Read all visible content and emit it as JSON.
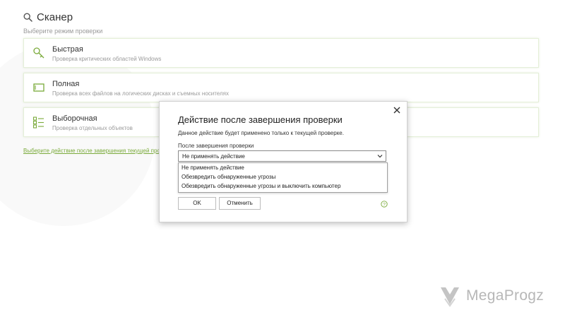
{
  "header": {
    "title": "Сканер",
    "subtitle": "Выберите режим проверки",
    "icon": "search-icon"
  },
  "scan_modes": [
    {
      "title": "Быстрая",
      "description": "Проверка критических областей Windows",
      "icon": "key-icon"
    },
    {
      "title": "Полная",
      "description": "Проверка всех файлов на логических дисках и съемных носителях",
      "icon": "drive-icon"
    },
    {
      "title": "Выборочная",
      "description": "Проверка отдельных объектов",
      "icon": "checklist-icon"
    }
  ],
  "after_scan_link": "Выберите действие после завершения текущей проверки",
  "dialog": {
    "title": "Действие после завершения проверки",
    "note": "Данное действие будет применено только к текущей проверке.",
    "field_label": "После завершения проверки",
    "selected": "Не применять действие",
    "options": [
      "Не применять действие",
      "Обезвредить обнаруженные угрозы",
      "Обезвредить обнаруженные угрозы и выключить компьютер"
    ],
    "ok_label": "OK",
    "cancel_label": "Отменить"
  },
  "watermark": {
    "text": "MegaProgz"
  },
  "colors": {
    "accent": "#7aaa3a",
    "card_border": "#e4efd8",
    "text": "#333333",
    "muted": "#9a9a9a"
  }
}
